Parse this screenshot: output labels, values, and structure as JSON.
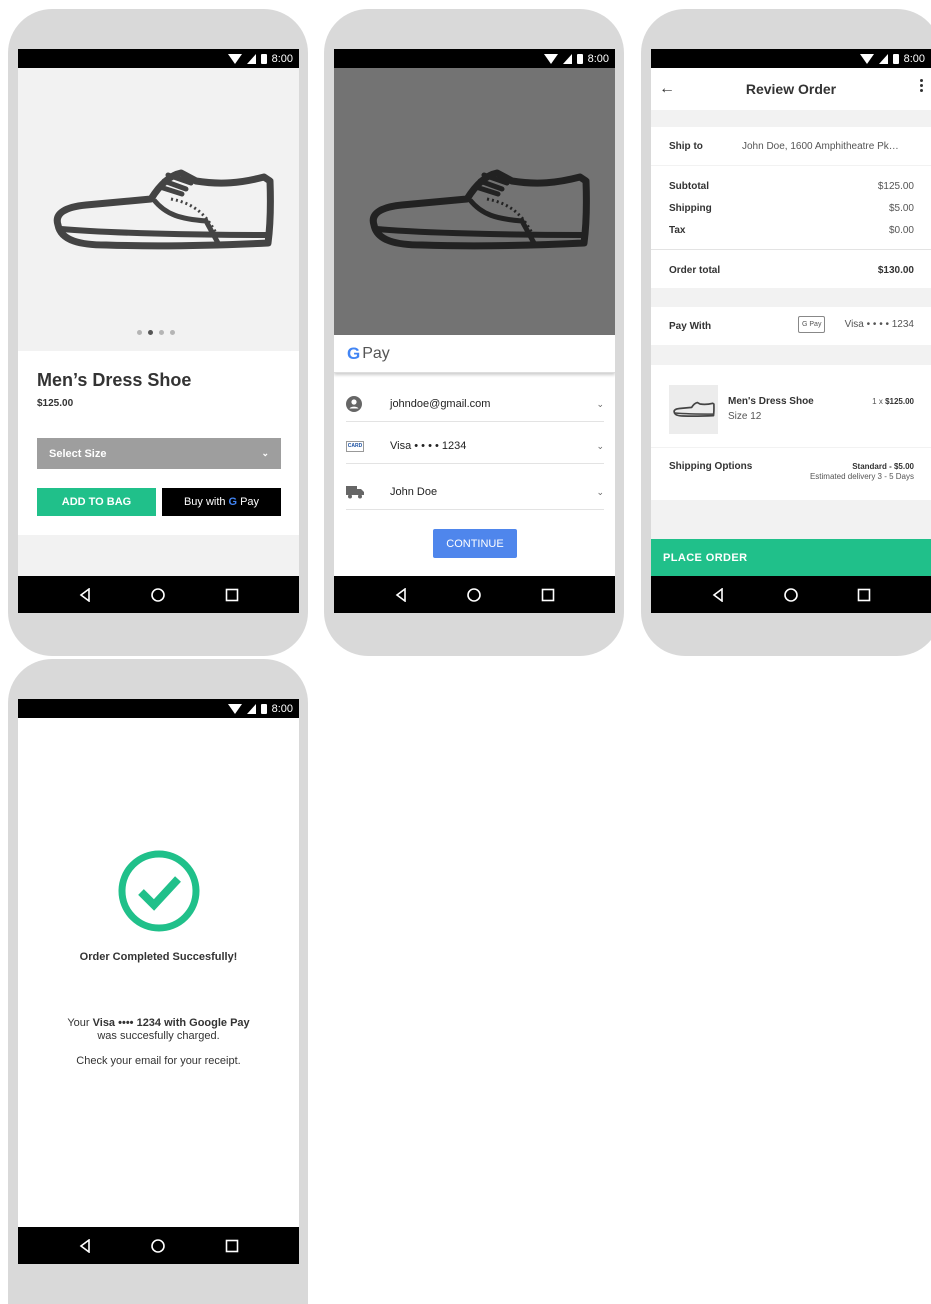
{
  "status": {
    "time": "8:00"
  },
  "screen1": {
    "product_name": "Men’s Dress Shoe",
    "price": "$125.00",
    "size_select": "Select Size",
    "add_to_bag": "ADD TO BAG",
    "buy_with": "Buy with",
    "gpay_pay": "Pay",
    "carousel_dots": 4,
    "carousel_active": 1
  },
  "screen2": {
    "sheet_pay": "Pay",
    "email": "johndoe@gmail.com",
    "card_badge": "CARD",
    "card": "Visa • • • • 1234",
    "name": "John Doe",
    "continue": "CONTINUE"
  },
  "screen3": {
    "title": "Review Order",
    "ship_to_label": "Ship to",
    "ship_to_value": "John Doe, 1600 Amphitheatre Pk…",
    "subtotal_label": "Subtotal",
    "subtotal_value": "$125.00",
    "shipping_label": "Shipping",
    "shipping_value": "$5.00",
    "tax_label": "Tax",
    "tax_value": "$0.00",
    "order_total_label": "Order total",
    "order_total_value": "$130.00",
    "pay_with_label": "Pay With",
    "gpay_badge": "G Pay",
    "pay_with_value": "Visa • • • • 1234",
    "item_name": "Men's Dress Shoe",
    "item_size": "Size 12",
    "item_qty": "1 x",
    "item_price": "$125.00",
    "shipping_options_label": "Shipping Options",
    "shipping_option": "Standard - $5.00",
    "shipping_eta": "Estimated delivery 3 - 5 Days",
    "place_order": "PLACE ORDER"
  },
  "screen4": {
    "title": "Order Completed Succesfully!",
    "line1_pre": "Your",
    "line1_bold": "Visa •••• 1234 with Google Pay",
    "line2": "was succesfully charged.",
    "line3": "Check your email for your receipt."
  },
  "colors": {
    "accent_green": "#20c08a",
    "continue_blue": "#4f86ec",
    "product_bg": "#f2f2f2",
    "dimmed_bg": "#737373",
    "select_grey": "#9e9e9e"
  }
}
